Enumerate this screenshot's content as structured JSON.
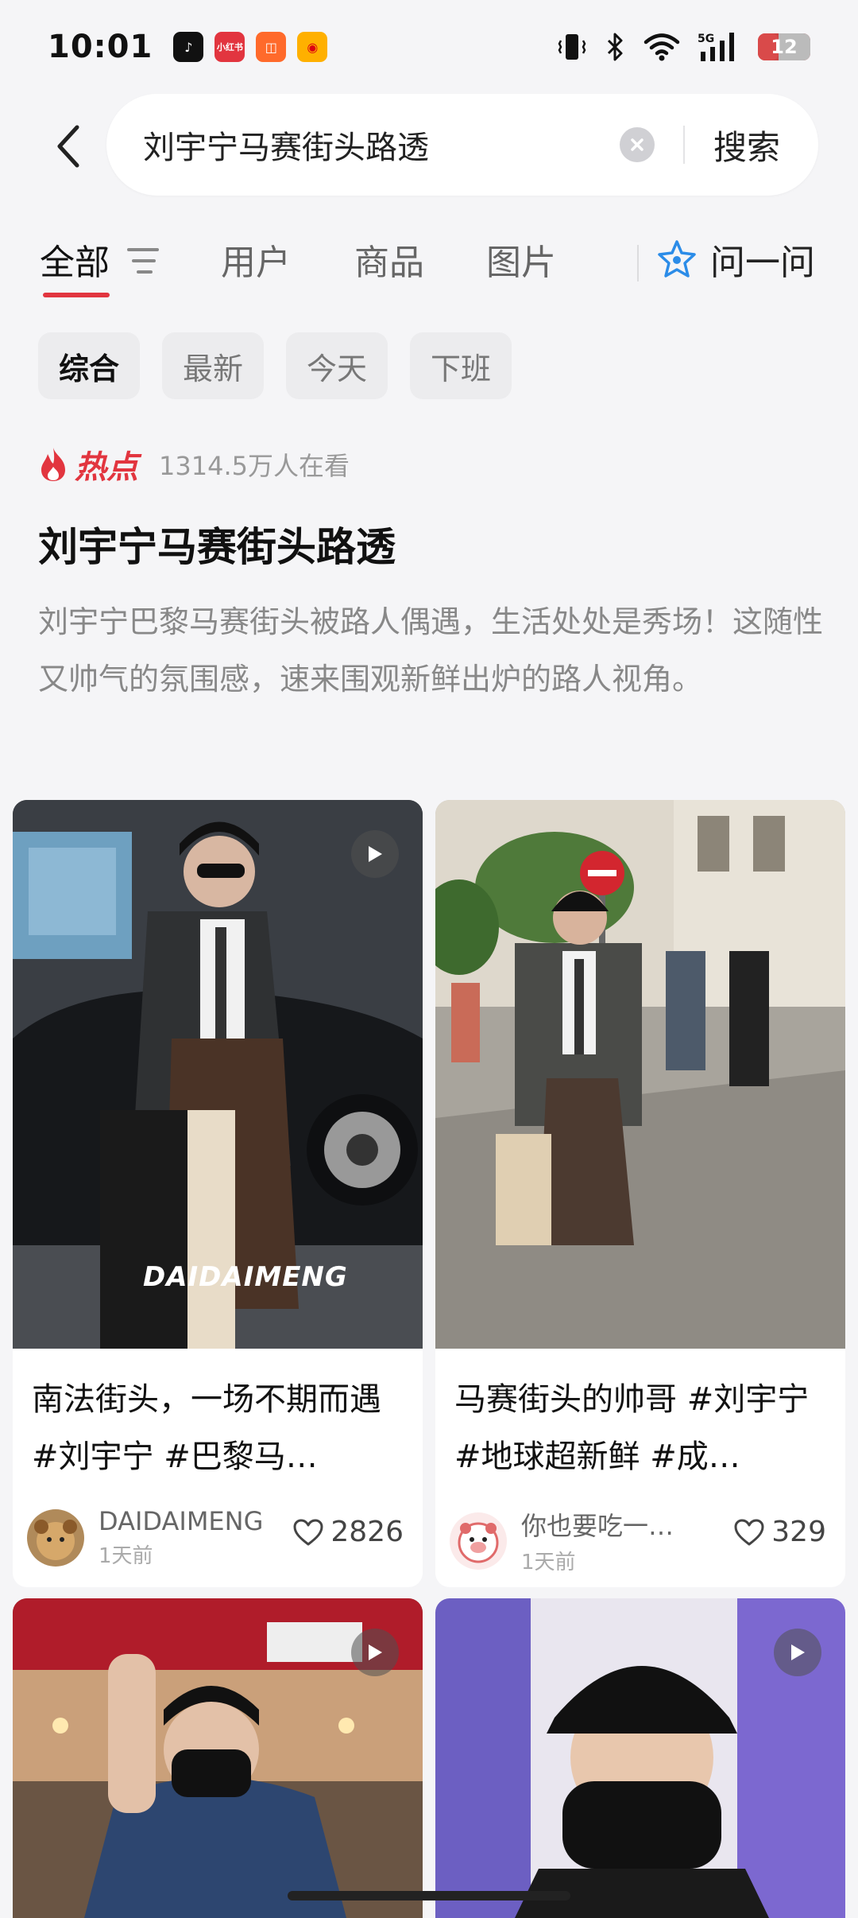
{
  "status_bar": {
    "time": "10:01",
    "app_icons": [
      {
        "name": "tiktok-icon",
        "color": "#111111",
        "glyph": "♪"
      },
      {
        "name": "xiaohongshu-icon",
        "color": "#e2353f",
        "glyph": "小红书"
      },
      {
        "name": "app-icon",
        "color": "#ff6a2b",
        "glyph": "◫"
      },
      {
        "name": "weibo-icon",
        "color": "#ffb000",
        "glyph": "◉"
      }
    ],
    "battery": "12",
    "network": "5G"
  },
  "search": {
    "query": "刘宇宁马赛街头路透",
    "submit_label": "搜索"
  },
  "tabs": {
    "items": [
      "全部",
      "用户",
      "商品",
      "图片"
    ],
    "active": "全部",
    "ask_label": "问一问"
  },
  "chips": {
    "items": [
      "综合",
      "最新",
      "今天",
      "下班"
    ],
    "active": "综合"
  },
  "hot": {
    "label": "热点",
    "views": "1314.5万人在看",
    "title": "刘宇宁马赛街头路透",
    "description": "刘宇宁巴黎马赛街头被路人偶遇，生活处处是秀场！这随性又帅气的氛围感，速来围观新鲜出炉的路人视角。"
  },
  "cards": [
    {
      "title": "南法街头，一场不期而遇 #刘宇宁 #巴黎马…",
      "author": "DAIDAIMENG",
      "time": "1天前",
      "likes": "2826",
      "watermark": "DAIDAIMENG",
      "is_video": true
    },
    {
      "title": "马赛街头的帅哥 #刘宇宁 #地球超新鲜 #成…",
      "author": "你也要吃一…",
      "time": "1天前",
      "likes": "329",
      "is_video": false
    },
    {
      "is_video": true
    },
    {
      "is_video": true
    }
  ],
  "colors": {
    "accent": "#e2353f",
    "background": "#f5f5f7",
    "ask_icon": "#2b8ce8"
  }
}
